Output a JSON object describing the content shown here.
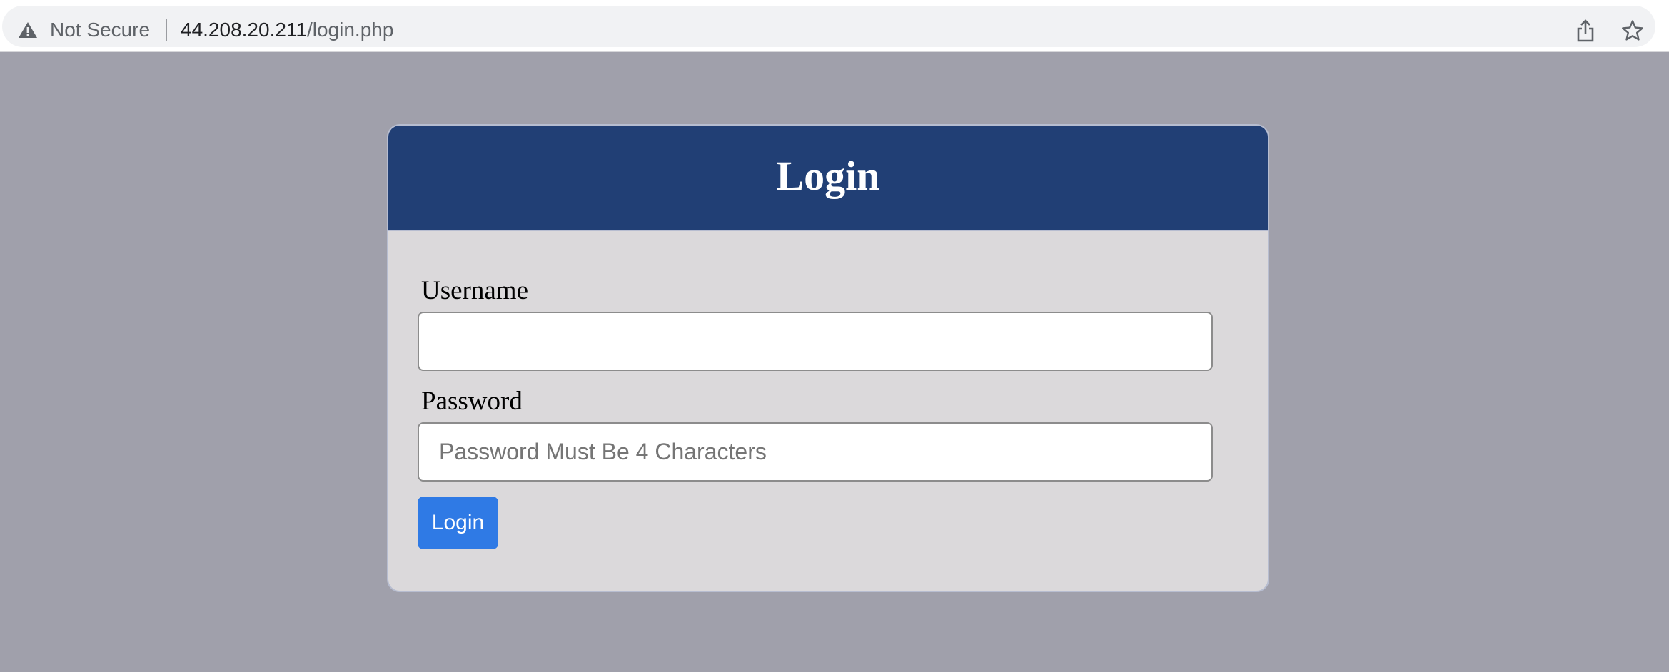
{
  "browser": {
    "security_label": "Not Secure",
    "url_host": "44.208.20.211",
    "url_path": "/login.php",
    "icons": {
      "warning": "warning-triangle-icon",
      "share": "share-icon",
      "bookmark": "star-icon"
    }
  },
  "login_form": {
    "title": "Login",
    "username_label": "Username",
    "username_value": "",
    "username_placeholder": "",
    "password_label": "Password",
    "password_value": "",
    "password_placeholder": "Password Must Be 4 Characters",
    "submit_label": "Login"
  },
  "colors": {
    "page_background": "#a0a0ab",
    "header_background": "#213f75",
    "card_background": "#dbd9db",
    "button_background": "#2f7ae5"
  }
}
